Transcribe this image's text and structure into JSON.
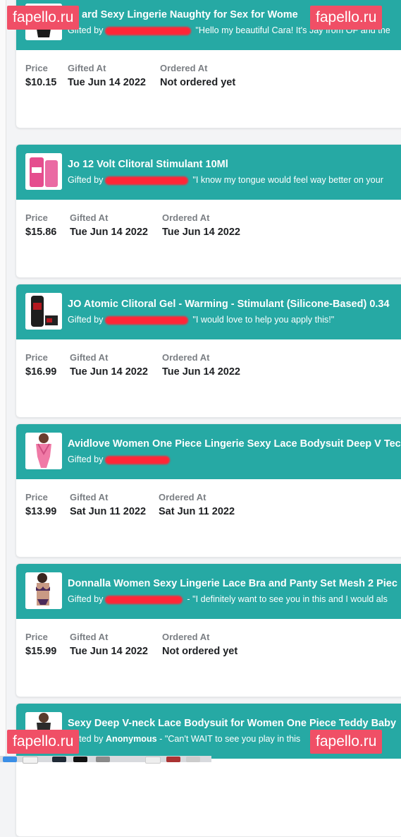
{
  "watermark": {
    "text": "fapello.ru"
  },
  "labels": {
    "price": "Price",
    "gifted_at": "Gifted At",
    "ordered_at": "Ordered At",
    "gifted_by": "Gifted by"
  },
  "colors": {
    "header": "#26a9a4",
    "redaction": "#ff2637",
    "watermark": "#f04f66"
  },
  "gifts": [
    {
      "title": "ard Sexy Lingerie Naughty for Sex for Wome",
      "message": "\"Hello my beautiful Cara! It's Jay from OF and the",
      "price": "$10.15",
      "gifted_at": "Tue Jun 14 2022",
      "ordered_at": "Not ordered yet"
    },
    {
      "title": "Jo 12 Volt Clitoral Stimulant 10Ml",
      "message": "\"I know my tongue would feel way better on your",
      "price": "$15.86",
      "gifted_at": "Tue Jun 14 2022",
      "ordered_at": "Tue Jun 14 2022"
    },
    {
      "title": "JO Atomic Clitoral Gel - Warming - Stimulant (Silicone-Based) 0.34",
      "message": "\"I would love to help you apply this!\"",
      "price": "$16.99",
      "gifted_at": "Tue Jun 14 2022",
      "ordered_at": "Tue Jun 14 2022"
    },
    {
      "title": "Avidlove Women One Piece Lingerie Sexy Lace Bodysuit Deep V Tec",
      "message": "",
      "price": "$13.99",
      "gifted_at": "Sat Jun 11 2022",
      "ordered_at": "Sat Jun 11 2022"
    },
    {
      "title": "Donnalla Women Sexy Lingerie Lace Bra and Panty Set Mesh 2 Piec",
      "message": "- \"I definitely want to see you in this and I would als",
      "price": "$15.99",
      "gifted_at": "Tue Jun 14 2022",
      "ordered_at": "Not ordered yet"
    },
    {
      "title": "Sexy Deep V-neck Lace Bodysuit for Women One Piece Teddy Baby",
      "gifted_by_name": "Anonymous",
      "message": "- \"Can't WAIT to see you play in this",
      "price": "",
      "gifted_at": "",
      "ordered_at": ""
    }
  ]
}
